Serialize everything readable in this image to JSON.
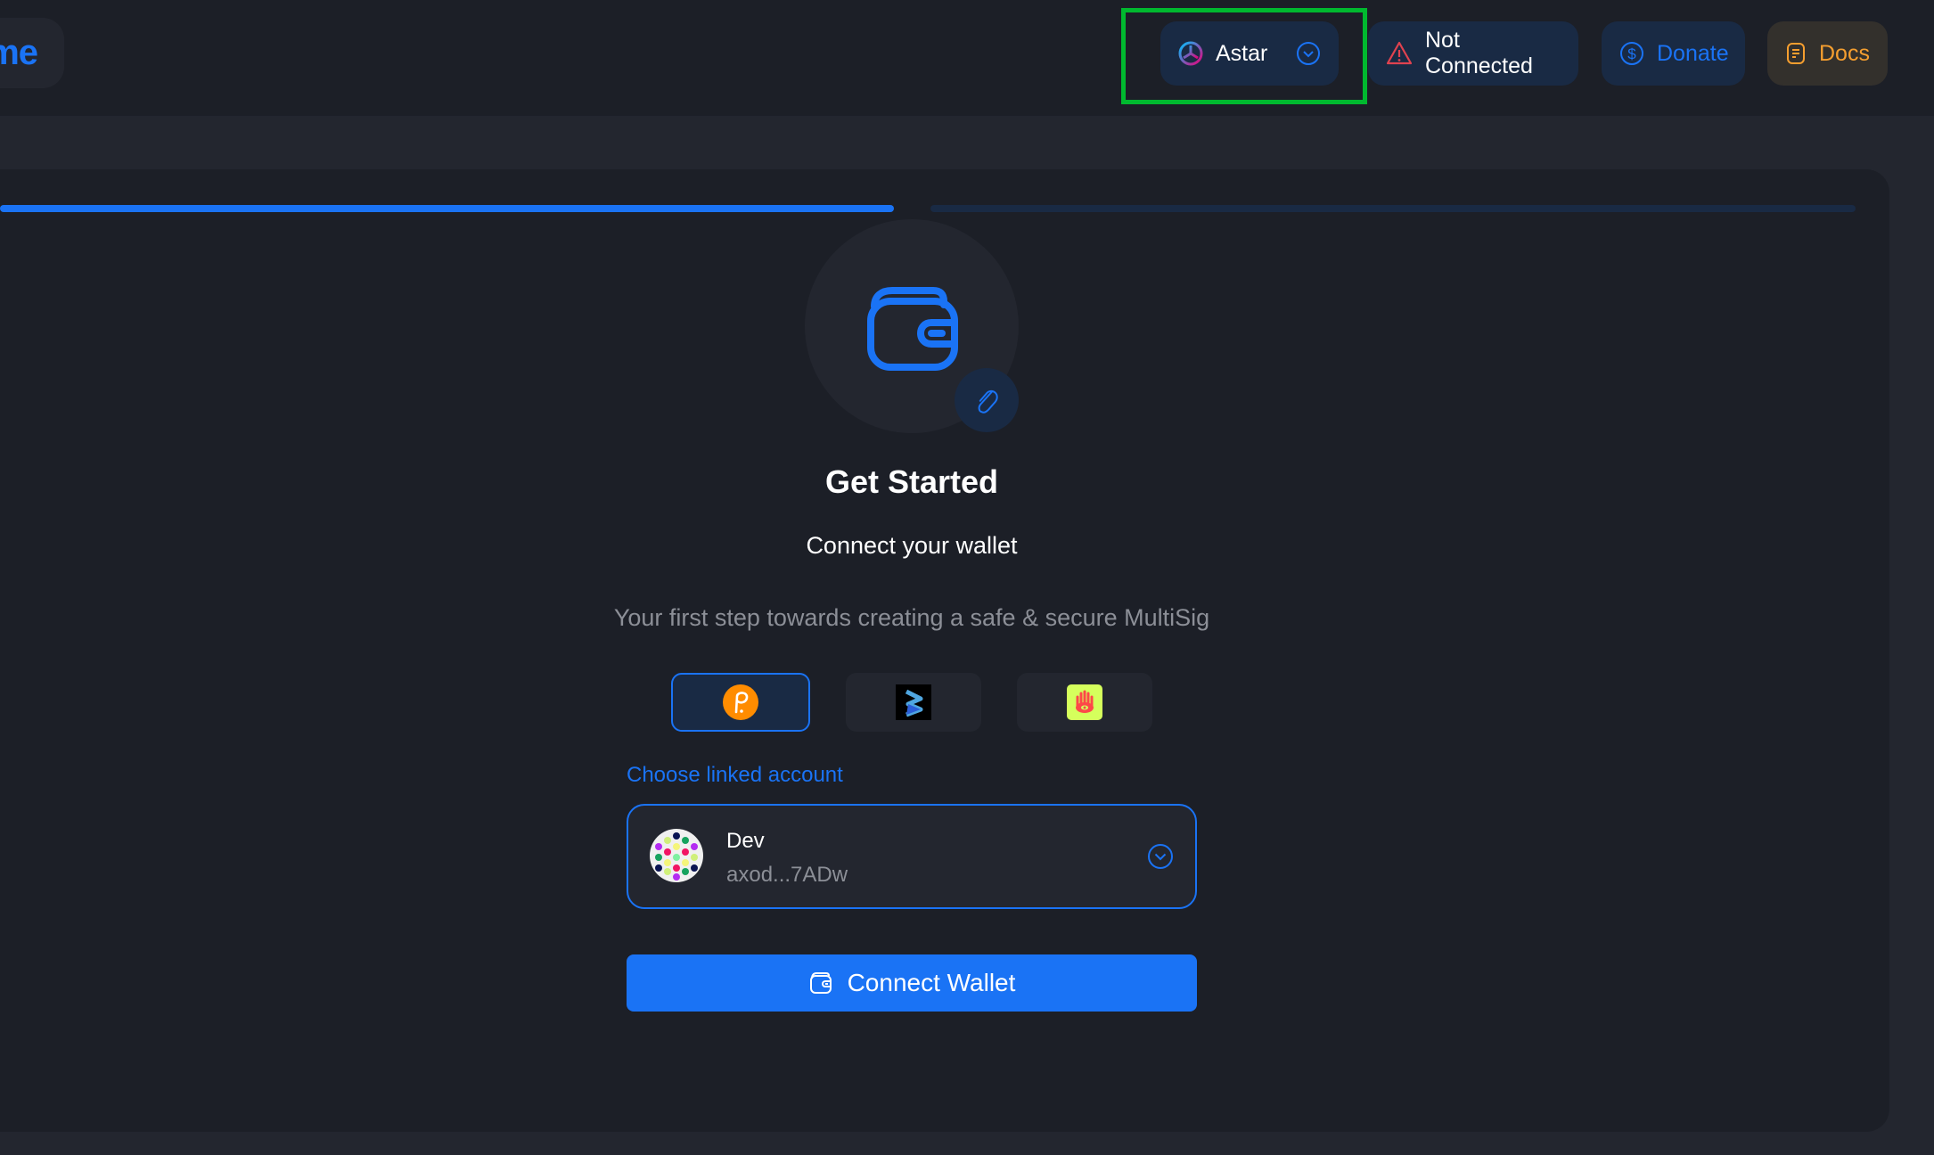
{
  "header": {
    "logo_text": "me",
    "network": {
      "label": "Astar",
      "icon": "astar-logo-icon"
    },
    "status": {
      "label": "Not Connected",
      "icon": "warning-triangle-icon"
    },
    "donate": {
      "label": "Donate",
      "icon": "dollar-circle-icon"
    },
    "docs": {
      "label": "Docs",
      "icon": "document-icon"
    }
  },
  "colors": {
    "accent": "#1a73f5",
    "background": "#23262f",
    "card": "#1c1f27",
    "warning": "#e0424f",
    "docs": "#f59e2f",
    "highlight": "#00b92f"
  },
  "stepper": {
    "current_step": 1,
    "total_steps": 2
  },
  "main": {
    "title": "Get Started",
    "subtitle": "Connect your wallet",
    "description": "Your first step towards creating a safe & secure MultiSig",
    "extensions": [
      {
        "name": "Polkadot.js",
        "icon": "polkadot-js-icon",
        "selected": true
      },
      {
        "name": "SubWallet",
        "icon": "subwallet-icon",
        "selected": false
      },
      {
        "name": "Talisman",
        "icon": "talisman-icon",
        "selected": false
      }
    ],
    "account_label": "Choose linked account",
    "account": {
      "name": "Dev",
      "address": "axod...7ADw"
    },
    "connect_label": "Connect Wallet"
  }
}
